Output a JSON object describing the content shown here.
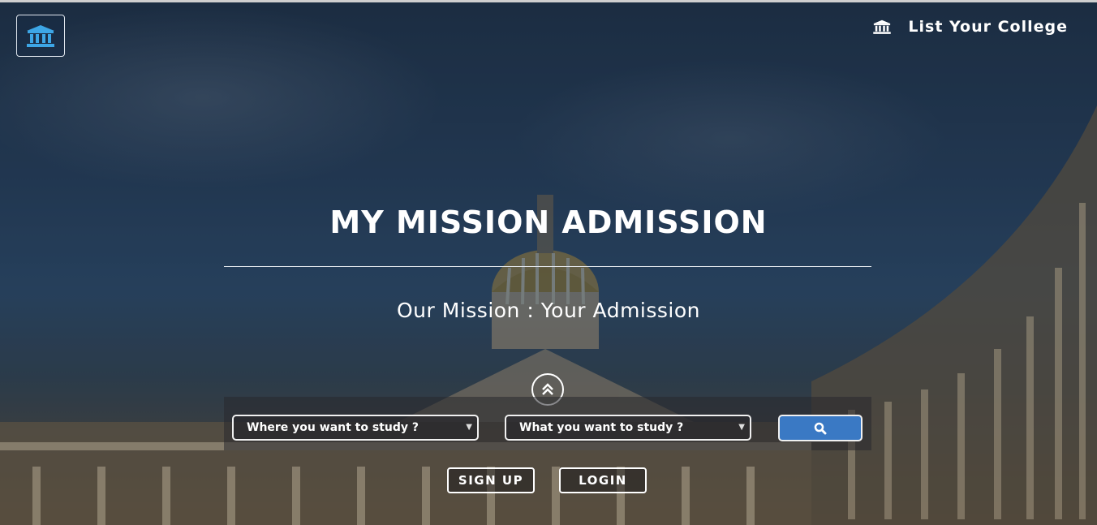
{
  "header": {
    "logo_icon": "institution-icon",
    "list_college_icon": "institution-icon",
    "list_college_label": "List Your College"
  },
  "hero": {
    "title": "MY MISSION ADMISSION",
    "subtitle": "Our Mission : Your Admission"
  },
  "search": {
    "scroll_up_icon": "double-chevron-up-icon",
    "location_select": "Where you want to study ?",
    "course_select": "What you want to study ?",
    "search_icon": "search-icon",
    "button_color": "#3a79c4"
  },
  "auth": {
    "signup_label": "SIGN UP",
    "login_label": "LOGIN"
  }
}
